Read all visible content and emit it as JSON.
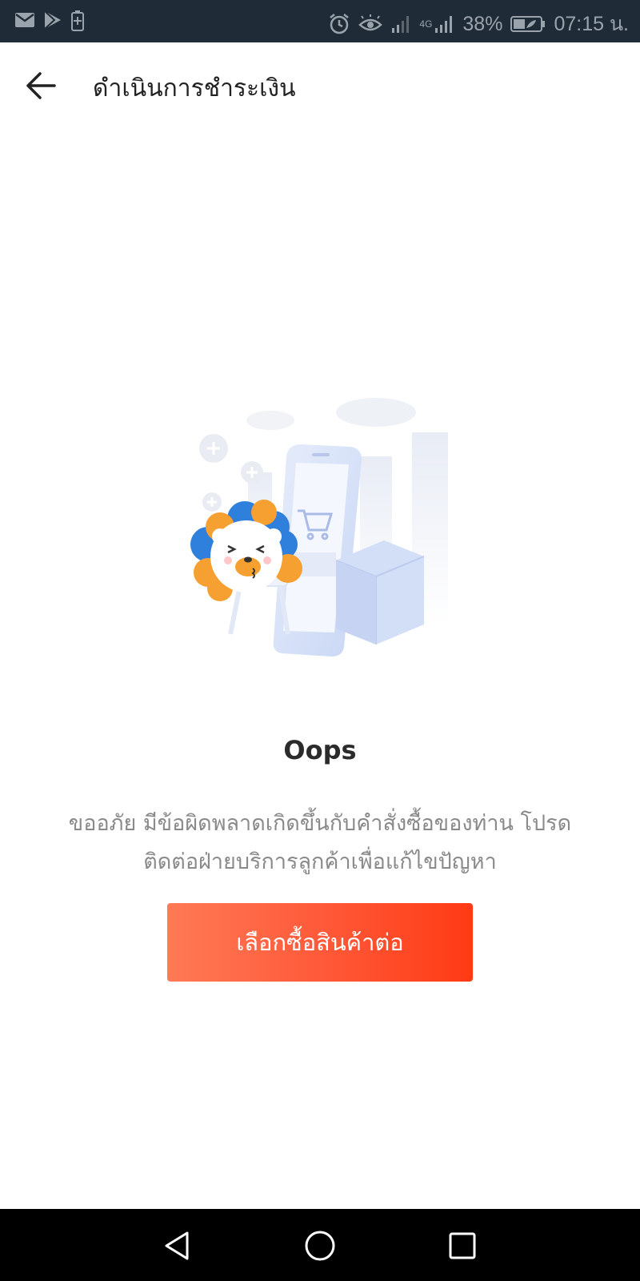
{
  "status_bar": {
    "battery_percent": "38%",
    "time": "07:15 น.",
    "network": "4G",
    "icons": [
      "mail-icon",
      "play-store-icon",
      "battery-saver-icon",
      "alarm-icon",
      "eye-comfort-icon",
      "signal-icon",
      "battery-icon"
    ]
  },
  "header": {
    "title": "ดำเนินการชำระเงิน",
    "back_icon": "arrow-left-icon"
  },
  "error": {
    "title": "Oops",
    "message_line1": "ขออภัย มีข้อผิดพลาดเกิดขึ้นกับคำสั่งซื้อของท่าน โปรด",
    "message_line2": "ติดต่อฝ่ายบริการลูกค้าเพื่อแก้ไขปัญหา"
  },
  "actions": {
    "continue_shopping_label": "เลือกซื้อสินค้าต่อ"
  },
  "nav": {
    "icons": [
      "back-triangle-icon",
      "home-circle-icon",
      "recents-square-icon"
    ]
  },
  "colors": {
    "status_bar": "#1f2c38",
    "button_start": "#ff7a55",
    "button_end": "#ff3a14",
    "lion_blue": "#2f7fdc",
    "lion_orange": "#f5a030"
  }
}
